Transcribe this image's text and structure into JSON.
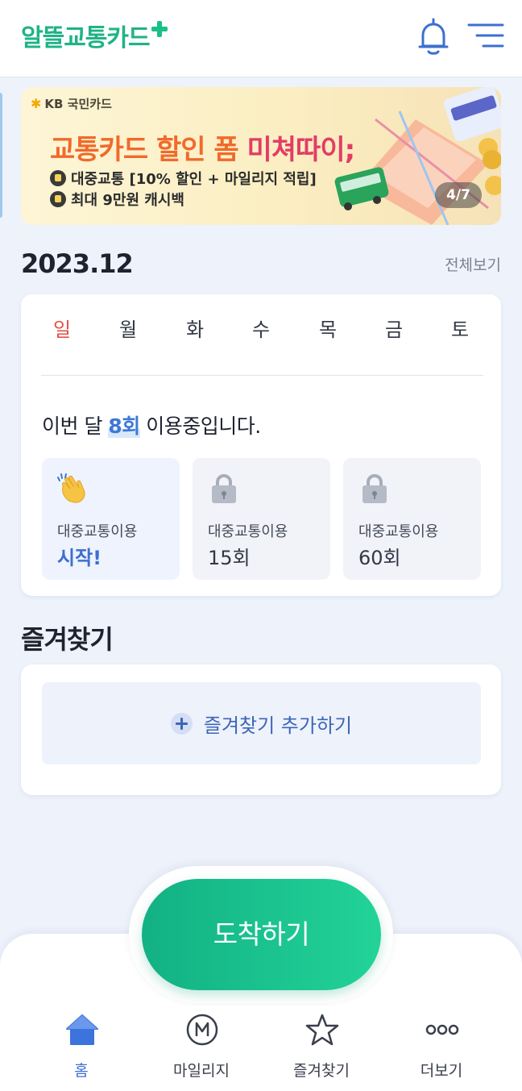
{
  "header": {
    "logo_text": "알뜰교통카드",
    "bell_icon": "bell-icon",
    "menu_icon": "hamburger-menu-icon"
  },
  "banner": {
    "sponsor": "KB 국민카드",
    "headline_main": "교통카드 할인 폼 ",
    "headline_highlight": "미쳐따이;",
    "line1": "대중교통 [10% 할인 + 마일리지 적립]",
    "line2": "최대 9만원 캐시백",
    "counter": "4/7"
  },
  "month": {
    "title": "2023.12",
    "view_all": "전체보기"
  },
  "calendar": {
    "weekdays": [
      "일",
      "월",
      "화",
      "수",
      "목",
      "금",
      "토"
    ],
    "usage_prefix": "이번 달 ",
    "usage_count": "8회",
    "usage_suffix": " 이용중입니다.",
    "tiles": [
      {
        "label": "대중교통이용",
        "value": "시작!",
        "icon": "clapping-hands-icon",
        "state": "achieved"
      },
      {
        "label": "대중교통이용",
        "value": "15회",
        "icon": "lock-icon",
        "state": "locked"
      },
      {
        "label": "대중교통이용",
        "value": "60회",
        "icon": "lock-icon",
        "state": "locked"
      }
    ]
  },
  "favorites": {
    "title": "즐겨찾기",
    "add_label": "즐겨찾기 추가하기"
  },
  "arrive_button": "도착하기",
  "nav": [
    {
      "label": "홈",
      "icon": "home-icon",
      "active": true
    },
    {
      "label": "마일리지",
      "icon": "mileage-icon",
      "active": false
    },
    {
      "label": "즐겨찾기",
      "icon": "star-icon",
      "active": false
    },
    {
      "label": "더보기",
      "icon": "more-dots-icon",
      "active": false
    }
  ],
  "colors": {
    "brand_green": "#1fb386",
    "accent_blue": "#3c78d8",
    "sunday_red": "#e2524a",
    "page_bg": "#eef2fb"
  }
}
